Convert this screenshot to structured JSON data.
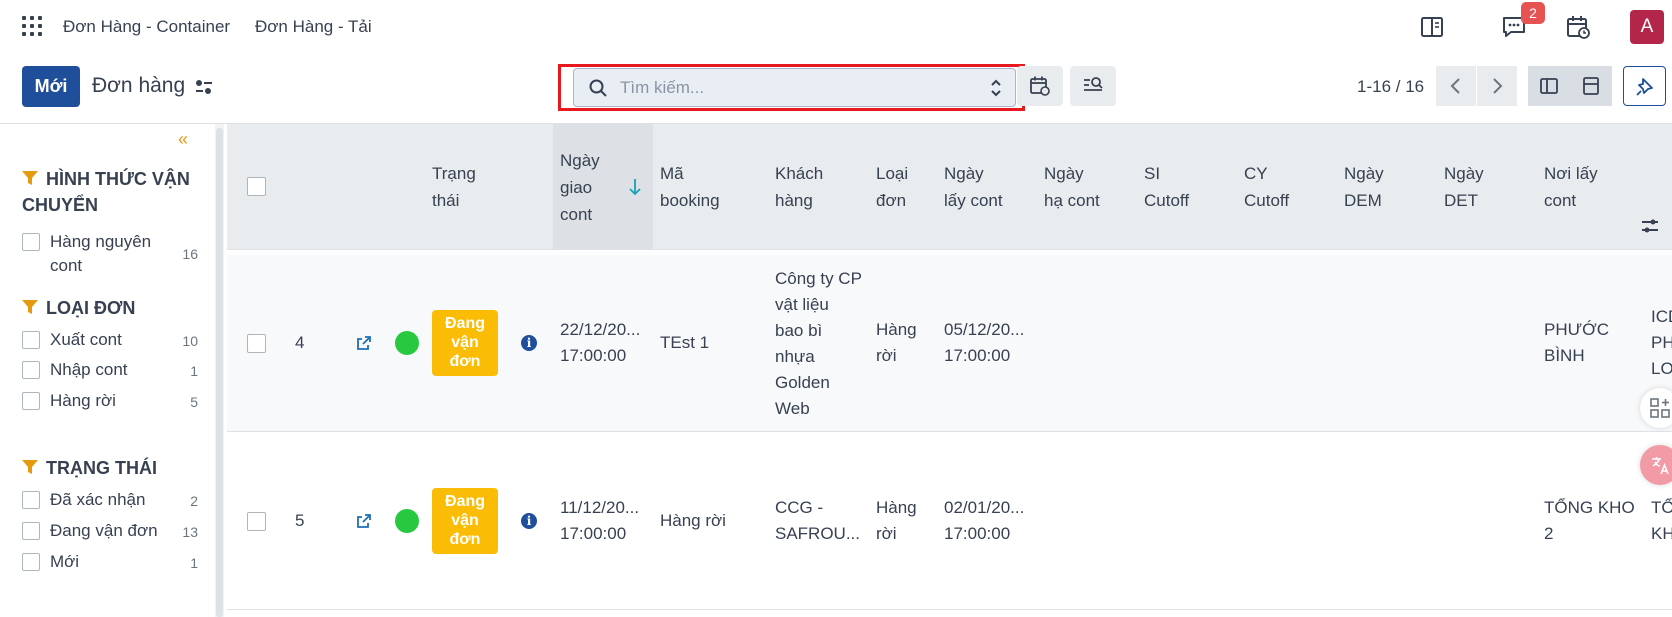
{
  "topbar": {
    "nav_items": [
      "Đơn Hàng - Container",
      "Đơn Hàng - Tải"
    ],
    "messages_badge": "2",
    "avatar_letter": "A"
  },
  "control": {
    "new_button": "Mới",
    "breadcrumb": "Đơn hàng",
    "search_placeholder": "Tìm kiếm...",
    "pager": "1-16 / 16"
  },
  "sidebar": {
    "groups": [
      {
        "title_line1": "HÌNH THỨC VẬN",
        "title_line2": "CHUYỂN",
        "items": [
          {
            "label_line1": "Hàng nguyên",
            "label_line2": "cont",
            "count": "16"
          }
        ]
      },
      {
        "title": "LOẠI ĐƠN",
        "items": [
          {
            "label": "Xuất cont",
            "count": "10"
          },
          {
            "label": "Nhập cont",
            "count": "1"
          },
          {
            "label": "Hàng rời",
            "count": "5"
          }
        ]
      },
      {
        "title": "TRẠNG THÁI",
        "items": [
          {
            "label": "Đã xác nhận",
            "count": "2"
          },
          {
            "label": "Đang vận đơn",
            "count": "13"
          },
          {
            "label": "Mới",
            "count": "1"
          }
        ]
      }
    ]
  },
  "table": {
    "headers": {
      "trang_thai": [
        "Trạng",
        "thái"
      ],
      "ngay_giao_cont": [
        "Ngày",
        "giao",
        "cont"
      ],
      "ma_booking": [
        "Mã",
        "booking"
      ],
      "khach_hang": [
        "Khách",
        "hàng"
      ],
      "loai_don": [
        "Loại",
        "đơn"
      ],
      "ngay_lay_cont": [
        "Ngày",
        "lấy cont"
      ],
      "ngay_ha_cont": [
        "Ngày",
        "hạ cont"
      ],
      "si_cutoff": [
        "SI",
        "Cutoff"
      ],
      "cy_cutoff": [
        "CY",
        "Cutoff"
      ],
      "ngay_dem": [
        "Ngày",
        "DEM"
      ],
      "ngay_det": [
        "Ngày",
        "DET"
      ],
      "noi_lay_cont": [
        "Nơi lấy",
        "cont"
      ]
    },
    "rows": [
      {
        "seq": "4",
        "status": [
          "Đang",
          "vận",
          "đơn"
        ],
        "ngay_giao": [
          "22/12/20...",
          "17:00:00"
        ],
        "booking": "TEst 1",
        "customer": [
          "Công ty CP",
          "vật liệu",
          "bao bì",
          "nhựa",
          "Golden",
          "Web"
        ],
        "loai": [
          "Hàng",
          "rời"
        ],
        "ngay_lay": [
          "05/12/20...",
          "17:00:00"
        ],
        "noi_lay": [
          "PHƯỚC",
          "BÌNH"
        ],
        "next_col": [
          "ICD",
          "PHƯ",
          "LON"
        ]
      },
      {
        "seq": "5",
        "status": [
          "Đang",
          "vận",
          "đơn"
        ],
        "ngay_giao": [
          "11/12/20...",
          "17:00:00"
        ],
        "booking": "Hàng rời",
        "customer": [
          "CCG -",
          "SAFROU..."
        ],
        "loai": [
          "Hàng",
          "rời"
        ],
        "ngay_lay": [
          "02/01/20...",
          "17:00:00"
        ],
        "noi_lay": [
          "TỔNG KHO",
          "2"
        ],
        "next_col": [
          "TỔN",
          "KHO"
        ]
      }
    ]
  },
  "colors": {
    "primary": "#1f4e9b",
    "status_badge": "#fbbc05",
    "status_dot": "#28c840",
    "search_highlight": "#e8191e",
    "filter_accent": "#e49b0f",
    "avatar": "#b4254a"
  },
  "icons": [
    "apps-grid-icon",
    "split-view-icon",
    "chat-icon",
    "calendar-clock-icon",
    "filter-settings-icon",
    "search-icon",
    "updown-toggle-icon",
    "calendar-filter-icon",
    "search-list-icon",
    "chevron-left-icon",
    "chevron-right-icon",
    "list-view-icon",
    "kanban-view-icon",
    "pin-icon",
    "double-chevron-left-icon",
    "funnel-icon",
    "sort-down-icon",
    "external-link-icon",
    "info-icon",
    "column-settings-icon"
  ]
}
